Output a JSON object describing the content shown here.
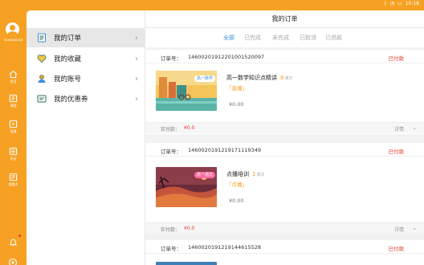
{
  "status_bar": {
    "time": "10:18"
  },
  "rail": {
    "username": "xxxxxxxxxx",
    "items": [
      {
        "label": "首页",
        "icon": "home-icon"
      },
      {
        "label": "课程",
        "icon": "book-icon"
      },
      {
        "label": "直播",
        "icon": "play-icon"
      },
      {
        "label": "作业",
        "icon": "homework-icon"
      },
      {
        "label": "错题本",
        "icon": "notes-icon"
      }
    ]
  },
  "menu": {
    "items": [
      {
        "label": "我的订单",
        "icon": "order-icon",
        "active": true
      },
      {
        "label": "我的收藏",
        "icon": "heart-icon"
      },
      {
        "label": "我的账号",
        "icon": "user-icon"
      },
      {
        "label": "我的优惠券",
        "icon": "coupon-icon"
      }
    ]
  },
  "main": {
    "title": "我的订单",
    "tabs": [
      "全部",
      "已完成",
      "未完成",
      "已取消",
      "已退款"
    ],
    "order_no_label": "订单号：",
    "paid_label": "实付款：",
    "detail_label": "详情",
    "lesson_unit": "课次",
    "orders": [
      {
        "order_no": "14600201912201001520097",
        "status": "已付款",
        "thumb_badge": "高一数学",
        "course_title": "高一数学知识点精讲",
        "lesson_count": "8",
        "tag": "「直播」",
        "price": "¥0.00",
        "paid": "¥0.0"
      },
      {
        "order_no": "1460020191219171119349",
        "status": "已付款",
        "thumb_badge": "高一语文",
        "course_title": "点播培训",
        "lesson_count": "1",
        "tag": "「点播」",
        "price": "¥0.00",
        "paid": "¥0.0"
      },
      {
        "order_no": "1460020191219144615528",
        "status": "已付款"
      }
    ]
  },
  "colors": {
    "accent": "#f6a123",
    "tab_active": "#3b8fd9",
    "status": "#e03c2f"
  }
}
